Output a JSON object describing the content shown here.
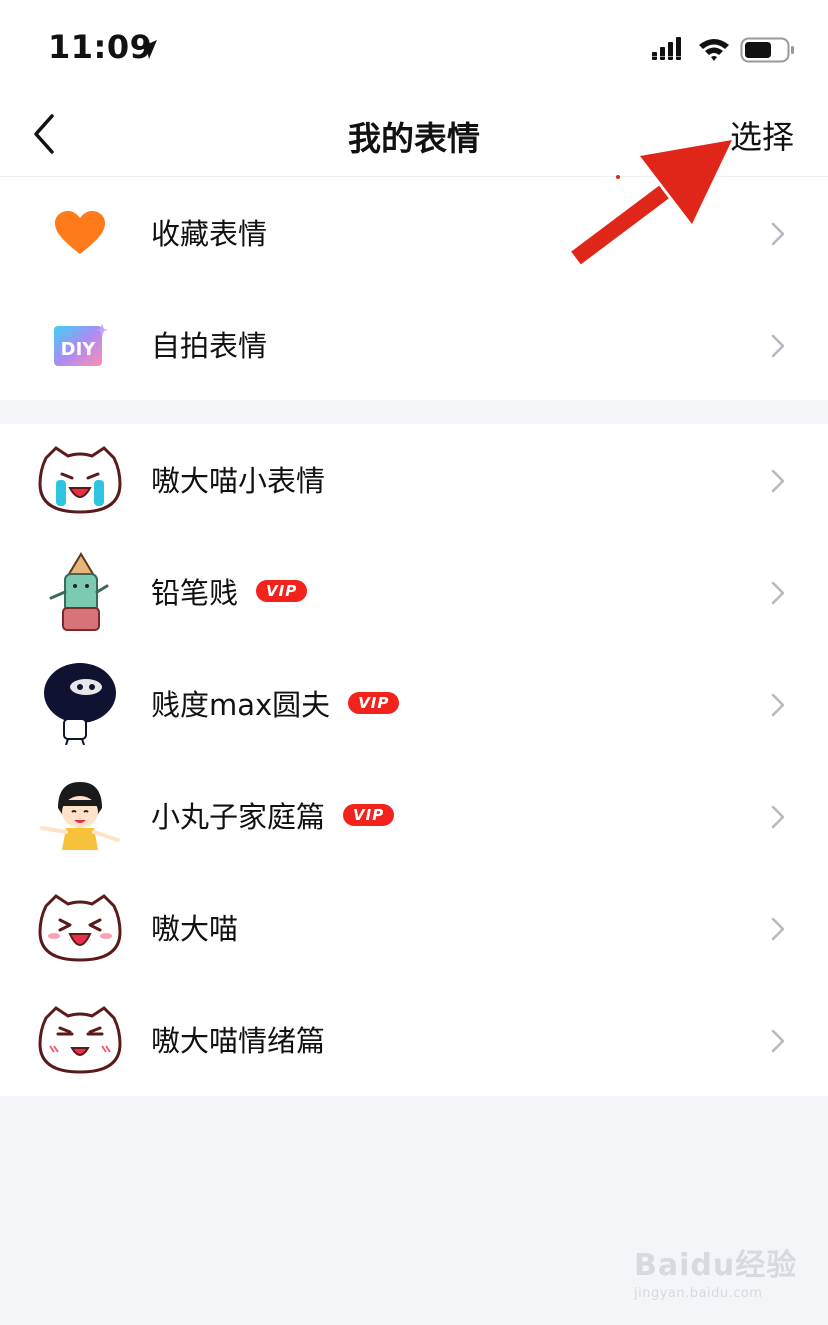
{
  "status_bar": {
    "time": "11:09"
  },
  "nav": {
    "title": "我的表情",
    "action_label": "选择"
  },
  "top_items": [
    {
      "label": "收藏表情",
      "icon": "heart-icon",
      "color": "#ff7a1a"
    },
    {
      "label": "自拍表情",
      "icon": "diy-icon",
      "icon_text": "DIY"
    }
  ],
  "sticker_packs": [
    {
      "label": "嗷大喵小表情",
      "vip": false
    },
    {
      "label": "铅笔贱",
      "vip": true
    },
    {
      "label": "贱度max圆夫",
      "vip": true
    },
    {
      "label": "小丸子家庭篇",
      "vip": true
    },
    {
      "label": "嗷大喵",
      "vip": false
    },
    {
      "label": "嗷大喵情绪篇",
      "vip": false
    }
  ],
  "vip_badge_text": "VIP",
  "colors": {
    "accent_red": "#f2231d",
    "arrow_red": "#e02618",
    "background": "#f4f5f9"
  },
  "watermark": {
    "main": "Baidu经验",
    "sub": "jingyan.baidu.com"
  }
}
